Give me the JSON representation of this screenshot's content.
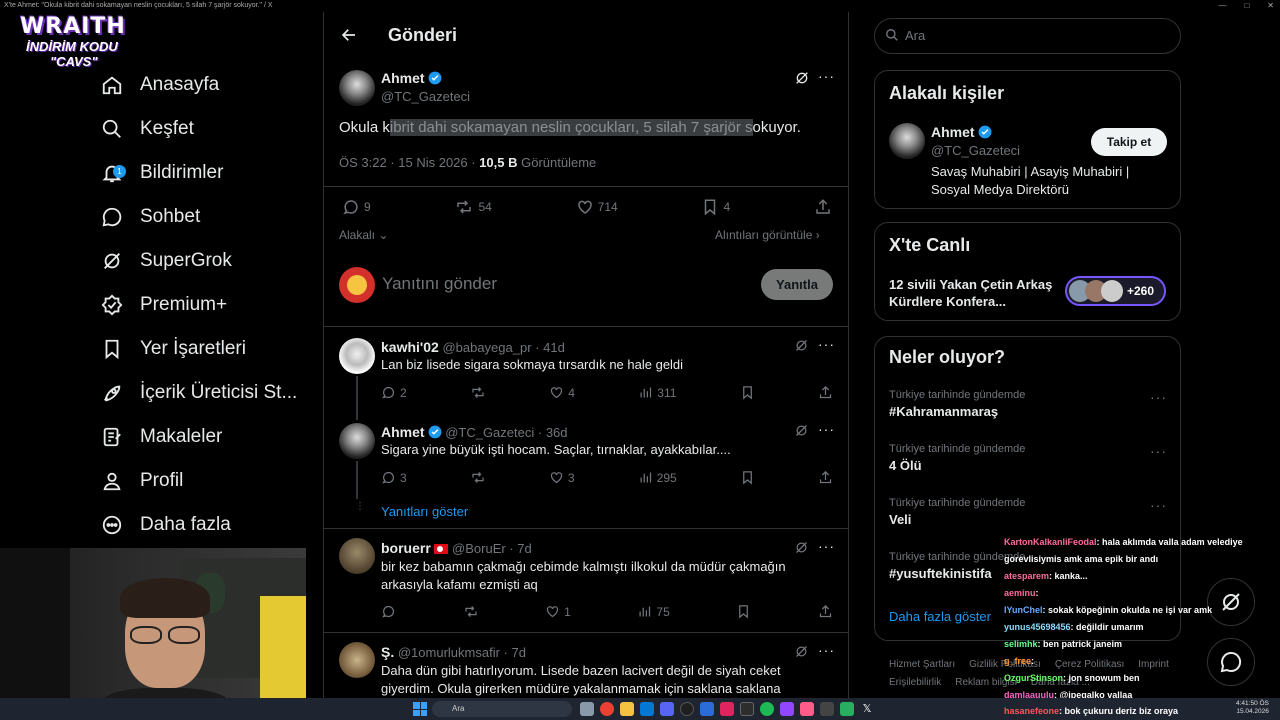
{
  "window": {
    "title": "X'te Ahmet: \"Okula kibrit dahi sokamayan neslin çocukları, 5 silah 7 şarjör sokuyor.\" / X",
    "controls": [
      "—",
      "□",
      "✕"
    ]
  },
  "overlay_logo": {
    "line1": "WRAITH",
    "line2": "İNDİRİM KODU",
    "line3": "\"CAVS\""
  },
  "sidebar": {
    "items": [
      {
        "label": "Anasayfa",
        "icon": "home-icon"
      },
      {
        "label": "Keşfet",
        "icon": "search-icon"
      },
      {
        "label": "Bildirimler",
        "icon": "bell-icon",
        "badge": "1"
      },
      {
        "label": "Sohbet",
        "icon": "chat-icon"
      },
      {
        "label": "SuperGrok",
        "icon": "grok-icon"
      },
      {
        "label": "Premium+",
        "icon": "verified-badge-icon"
      },
      {
        "label": "Yer İşaretleri",
        "icon": "bookmark-icon"
      },
      {
        "label": "İçerik Üreticisi St...",
        "icon": "rocket-icon"
      },
      {
        "label": "Makaleler",
        "icon": "article-icon"
      },
      {
        "label": "Profil",
        "icon": "person-icon"
      },
      {
        "label": "Daha fazla",
        "icon": "more-circle-icon"
      }
    ]
  },
  "header": {
    "title": "Gönderi"
  },
  "post": {
    "author": "Ahmet",
    "handle": "@TC_Gazeteci",
    "text_pre": "Okula k",
    "text_sel": "ibrit dahi sokamayan neslin çocukları, 5 silah 7 şarjör s",
    "text_post": "okuyor.",
    "time": "ÖS 3:22 · 15 Nis 2026 · ",
    "views_count": "10,5 B",
    "views_label": " Görüntüleme",
    "replies": "9",
    "reposts": "54",
    "likes": "714",
    "bookmarks": "4",
    "relevant": "Alakalı",
    "quotes_link": "Alıntıları görüntüle"
  },
  "composer": {
    "placeholder": "Yanıtını gönder",
    "button": "Yanıtla"
  },
  "replies": [
    {
      "author": "kawhi'02",
      "handle": "@babayega_pr",
      "time": "· 41d",
      "text": "Lan biz lisede sigara sokmaya tırsardık ne hale geldi",
      "replies": "2",
      "reposts": "",
      "likes": "4",
      "views": "311"
    },
    {
      "author": "Ahmet",
      "handle": "@TC_Gazeteci",
      "time": "· 36d",
      "text": "Sigara yine büyük işti hocam. Saçlar, tırnaklar, ayakkabılar....",
      "replies": "3",
      "reposts": "",
      "likes": "3",
      "views": "295"
    },
    {
      "author": "boruerr",
      "handle": "@BoruEr",
      "time": "· 7d",
      "text": "bir kez babamın çakmağı cebimde kalmıştı ilkokul da müdür çakmağın arkasıyla kafamı ezmişti aq",
      "replies": "",
      "reposts": "",
      "likes": "1",
      "views": "75"
    },
    {
      "author": "Ş.",
      "handle": "@1omurlukmsafir",
      "time": "· 7d",
      "text": "Daha dün gibi hatırlıyorum. Lisede bazen lacivert değil de siyah ceket giyerdim. Okula girerken müdüre yakalanmamak için saklana saklana"
    }
  ],
  "show_replies": "Yanıtları göster",
  "search": {
    "placeholder": "Ara"
  },
  "related": {
    "title": "Alakalı kişiler",
    "name": "Ahmet",
    "handle": "@TC_Gazeteci",
    "bio": "Savaş Muhabiri | Asayiş Muhabiri | Sosyal Medya Direktörü",
    "follow": "Takip et"
  },
  "live": {
    "title": "X'te Canlı",
    "headline": "12 sivili Yakan Çetin Arkaş Kürdlere Konfera...",
    "count": "+260"
  },
  "trends": {
    "title": "Neler oluyor?",
    "items": [
      {
        "sub": "Türkiye tarihinde gündemde",
        "main": "#Kahramanmaraş"
      },
      {
        "sub": "Türkiye tarihinde gündemde",
        "main": "4 Ölü"
      },
      {
        "sub": "Türkiye tarihinde gündemde",
        "main": "Veli"
      },
      {
        "sub": "Türkiye tarihinde gündemde",
        "main": "#yusuftekinistifa"
      }
    ],
    "more": "Daha fazla göster"
  },
  "footer": [
    "Hizmet Şartları",
    "Gizlilik Politikası",
    "Çerez Politikası",
    "Imprint",
    "Erişilebilirlik",
    "Reklam bilgisi",
    "Daha fazla ..."
  ],
  "chat": [
    {
      "user": "KartonKalkanliFeodal",
      "color": "#ff6b9a",
      "msg": ": hala aklımda valla adam velediye"
    },
    {
      "user": "",
      "color": "#fff",
      "msg": "gorevlisiymis amk ama epik bir andı"
    },
    {
      "user": "atesparem",
      "color": "#ff6b9a",
      "msg": ": kanka..."
    },
    {
      "user": "aeminu",
      "color": "#ff6b9a",
      "msg": ":"
    },
    {
      "user": "IYunChel",
      "color": "#66aaff",
      "msg": ": sokak köpeğinin okulda ne işi var amk"
    },
    {
      "user": "yunus45698456",
      "color": "#88ddff",
      "msg": ": değildir umarım"
    },
    {
      "user": "selimhk",
      "color": "#66ff88",
      "msg": ": ben patrick janeim"
    },
    {
      "user": "g_free",
      "color": "#ff9933",
      "msg": ":"
    },
    {
      "user": "OzgurStinson",
      "color": "#66ff66",
      "msg": ": jon snowum ben"
    },
    {
      "user": "damlaauulu",
      "color": "#ff66cc",
      "msg": ": @ipegalko vallaa"
    },
    {
      "user": "hasanefeone",
      "color": "#ff5555",
      "msg": ": bok çukuru deriz biz oraya"
    }
  ],
  "taskbar": {
    "search": "Ara",
    "time": "4:41:50 ÖS",
    "date": "15.04.2026"
  },
  "colors": {
    "accent": "#1d9bf0",
    "border": "#2f3336",
    "muted": "#71767b",
    "background": "#000000"
  }
}
